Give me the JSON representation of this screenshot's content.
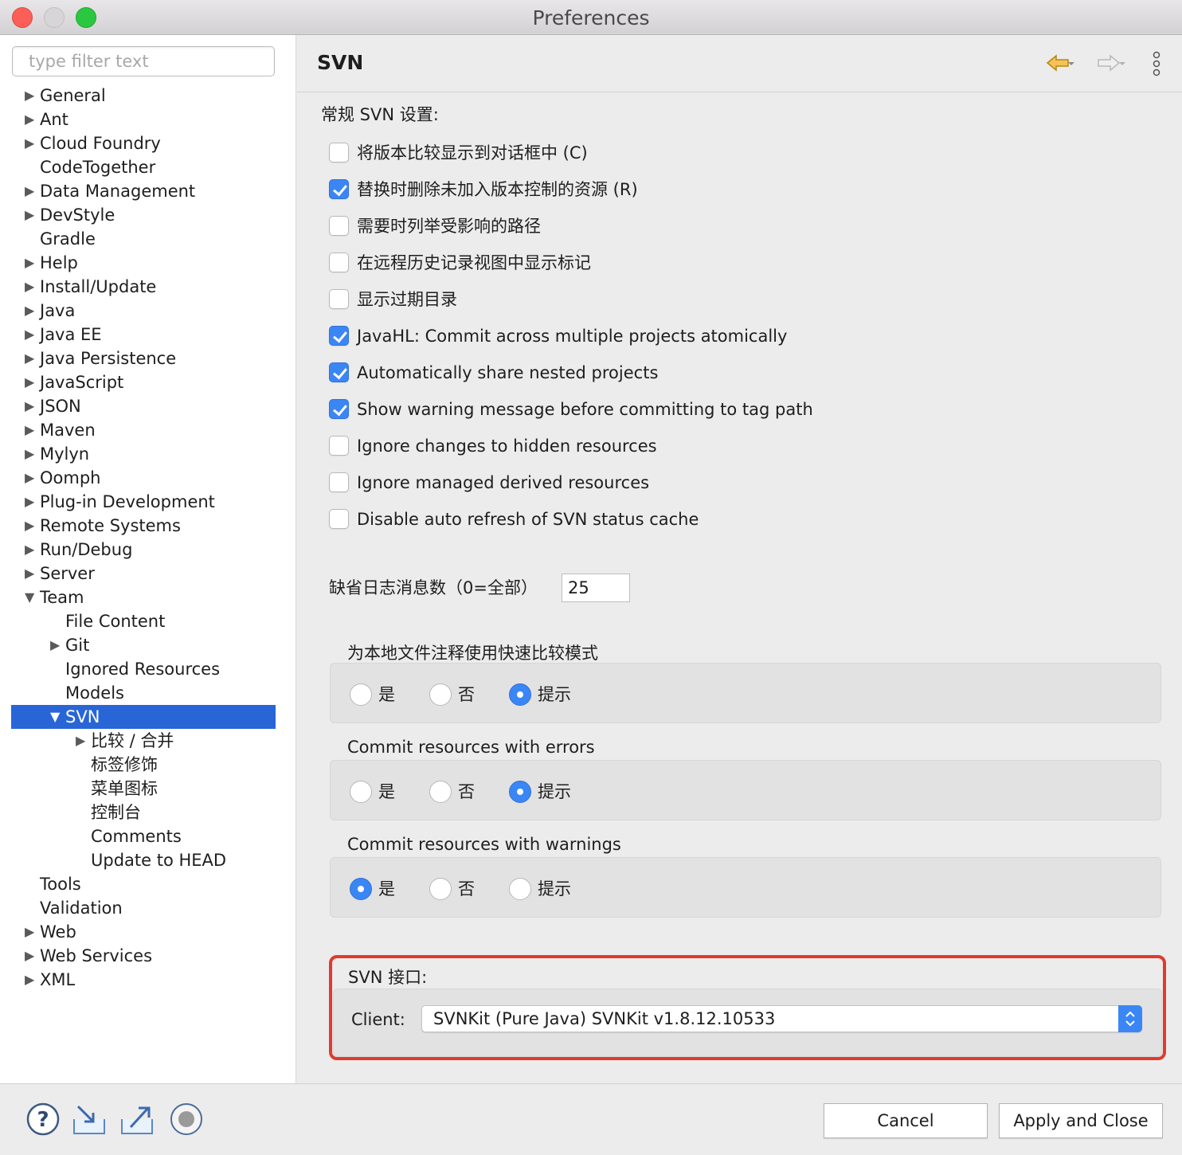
{
  "window": {
    "title": "Preferences"
  },
  "filter": {
    "placeholder": "type filter text"
  },
  "tree": [
    {
      "label": "General",
      "twisty": "collapsed",
      "level": 0
    },
    {
      "label": "Ant",
      "twisty": "collapsed",
      "level": 0
    },
    {
      "label": "Cloud Foundry",
      "twisty": "collapsed",
      "level": 0
    },
    {
      "label": "CodeTogether",
      "twisty": "none",
      "level": 0
    },
    {
      "label": "Data Management",
      "twisty": "collapsed",
      "level": 0
    },
    {
      "label": "DevStyle",
      "twisty": "collapsed",
      "level": 0
    },
    {
      "label": "Gradle",
      "twisty": "none",
      "level": 0
    },
    {
      "label": "Help",
      "twisty": "collapsed",
      "level": 0
    },
    {
      "label": "Install/Update",
      "twisty": "collapsed",
      "level": 0
    },
    {
      "label": "Java",
      "twisty": "collapsed",
      "level": 0
    },
    {
      "label": "Java EE",
      "twisty": "collapsed",
      "level": 0
    },
    {
      "label": "Java Persistence",
      "twisty": "collapsed",
      "level": 0
    },
    {
      "label": "JavaScript",
      "twisty": "collapsed",
      "level": 0
    },
    {
      "label": "JSON",
      "twisty": "collapsed",
      "level": 0
    },
    {
      "label": "Maven",
      "twisty": "collapsed",
      "level": 0
    },
    {
      "label": "Mylyn",
      "twisty": "collapsed",
      "level": 0
    },
    {
      "label": "Oomph",
      "twisty": "collapsed",
      "level": 0
    },
    {
      "label": "Plug-in Development",
      "twisty": "collapsed",
      "level": 0
    },
    {
      "label": "Remote Systems",
      "twisty": "collapsed",
      "level": 0
    },
    {
      "label": "Run/Debug",
      "twisty": "collapsed",
      "level": 0
    },
    {
      "label": "Server",
      "twisty": "collapsed",
      "level": 0
    },
    {
      "label": "Team",
      "twisty": "expanded",
      "level": 0
    },
    {
      "label": "File Content",
      "twisty": "none",
      "level": 1
    },
    {
      "label": "Git",
      "twisty": "collapsed",
      "level": 1
    },
    {
      "label": "Ignored Resources",
      "twisty": "none",
      "level": 1
    },
    {
      "label": "Models",
      "twisty": "none",
      "level": 1
    },
    {
      "label": "SVN",
      "twisty": "expanded",
      "level": 1,
      "selected": true
    },
    {
      "label": "比较 / 合并",
      "twisty": "collapsed",
      "level": 2
    },
    {
      "label": "标签修饰",
      "twisty": "none",
      "level": 2
    },
    {
      "label": "菜单图标",
      "twisty": "none",
      "level": 2
    },
    {
      "label": "控制台",
      "twisty": "none",
      "level": 2
    },
    {
      "label": "Comments",
      "twisty": "none",
      "level": 2
    },
    {
      "label": "Update to HEAD",
      "twisty": "none",
      "level": 2
    },
    {
      "label": "Tools",
      "twisty": "none",
      "level": 0
    },
    {
      "label": "Validation",
      "twisty": "none",
      "level": 0
    },
    {
      "label": "Web",
      "twisty": "collapsed",
      "level": 0
    },
    {
      "label": "Web Services",
      "twisty": "collapsed",
      "level": 0
    },
    {
      "label": "XML",
      "twisty": "collapsed",
      "level": 0
    }
  ],
  "page": {
    "title": "SVN",
    "section_title": "常规 SVN 设置:",
    "checkboxes": [
      {
        "label": "将版本比较显示到对话框中 (C)",
        "checked": false
      },
      {
        "label": "替换时删除未加入版本控制的资源 (R)",
        "checked": true
      },
      {
        "label": "需要时列举受影响的路径",
        "checked": false
      },
      {
        "label": "在远程历史记录视图中显示标记",
        "checked": false
      },
      {
        "label": "显示过期目录",
        "checked": false
      },
      {
        "label": "JavaHL: Commit across multiple projects atomically",
        "checked": true
      },
      {
        "label": "Automatically share nested projects",
        "checked": true
      },
      {
        "label": "Show warning message before committing to tag path",
        "checked": true
      },
      {
        "label": "Ignore changes to hidden resources",
        "checked": false
      },
      {
        "label": "Ignore managed derived resources",
        "checked": false
      },
      {
        "label": "Disable auto refresh of SVN status cache",
        "checked": false
      }
    ],
    "log_label": "缺省日志消息数（0=全部）",
    "log_value": "25",
    "radio_groups": [
      {
        "title": "为本地文件注释使用快速比较模式",
        "options": [
          "是",
          "否",
          "提示"
        ],
        "selected": 2
      },
      {
        "title": "Commit resources with errors",
        "options": [
          "是",
          "否",
          "提示"
        ],
        "selected": 2
      },
      {
        "title": "Commit resources with warnings",
        "options": [
          "是",
          "否",
          "提示"
        ],
        "selected": 0
      }
    ],
    "svn_interface": {
      "title": "SVN 接口:",
      "client_label": "Client:",
      "client_value": "SVNKit (Pure Java) SVNKit v1.8.12.10533"
    }
  },
  "buttons": {
    "cancel": "Cancel",
    "apply": "Apply and Close"
  },
  "colors": {
    "selection": "#2866d8",
    "accent": "#3b86f5",
    "highlight_border": "#e03b2f"
  }
}
